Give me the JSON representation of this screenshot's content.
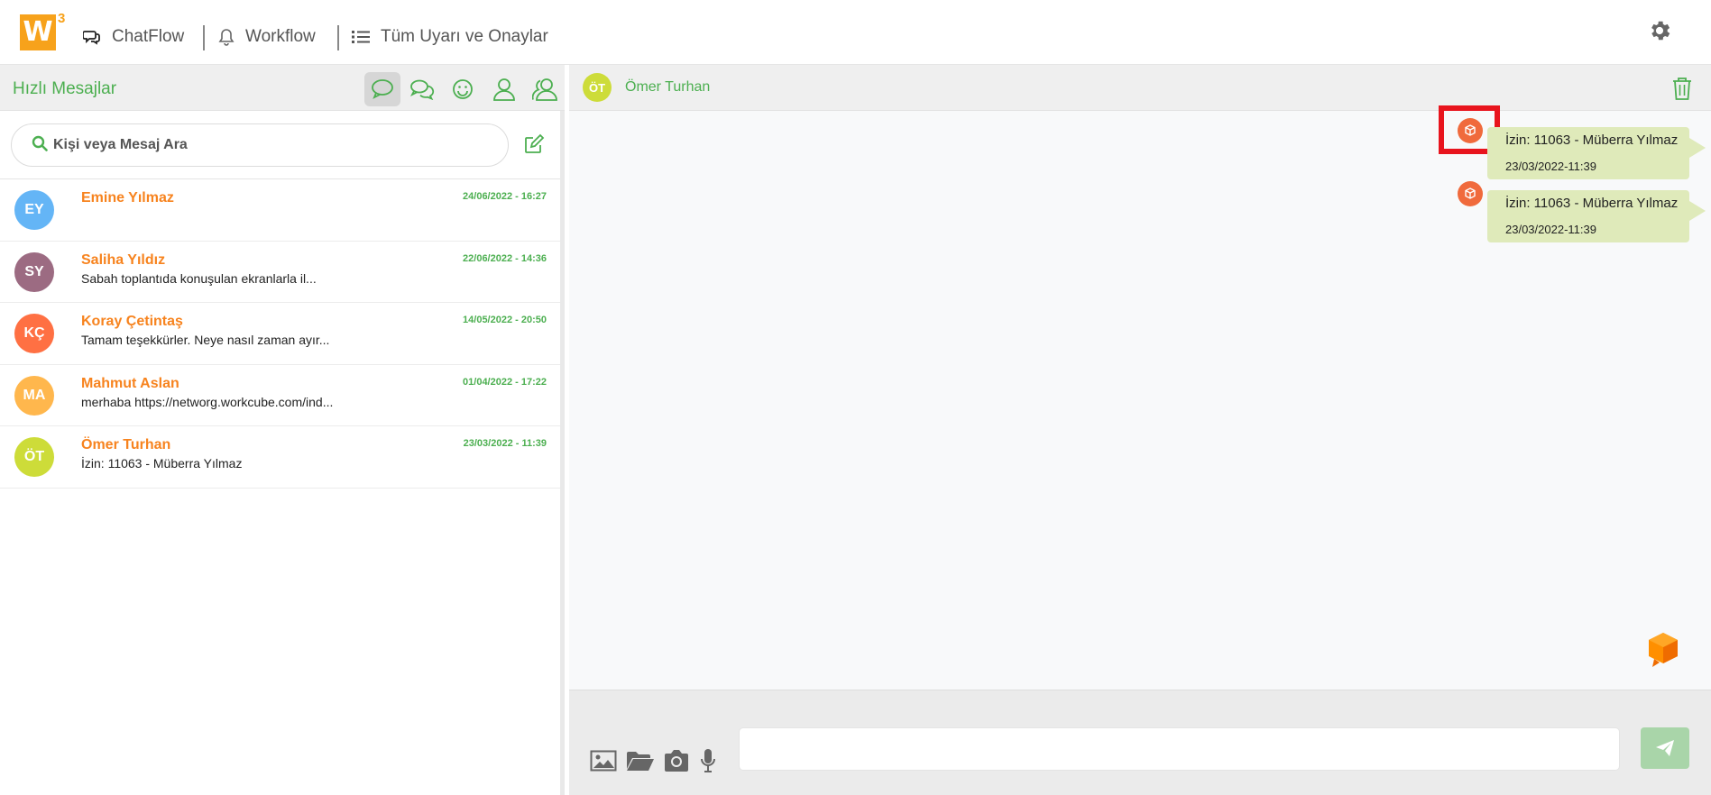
{
  "app": {
    "logo_text": "W",
    "logo_sup": "3"
  },
  "nav": {
    "items": [
      {
        "label": "ChatFlow"
      },
      {
        "label": "Workflow"
      },
      {
        "label": "Tüm Uyarı ve Onaylar"
      }
    ]
  },
  "sidebar": {
    "title": "Hızlı Mesajlar",
    "search_placeholder": "Kişi veya Mesaj Ara",
    "conversations": [
      {
        "initials": "EY",
        "name": "Emine Yılmaz",
        "preview": "",
        "time": "24/06/2022 - 16:27",
        "color": "#64b5f6"
      },
      {
        "initials": "SY",
        "name": "Saliha Yıldız",
        "preview": "Sabah toplantıda konuşulan ekranlarla il...",
        "time": "22/06/2022 - 14:36",
        "color": "#9c6b82"
      },
      {
        "initials": "KÇ",
        "name": "Koray Çetintaş",
        "preview": "Tamam teşekkürler. Neye nasıl zaman ayır...",
        "time": "14/05/2022 - 20:50",
        "color": "#ff7043"
      },
      {
        "initials": "MA",
        "name": "Mahmut Aslan",
        "preview": "merhaba https://networg.workcube.com/ind...",
        "time": "01/04/2022 - 17:22",
        "color": "#ffb74d"
      },
      {
        "initials": "ÖT",
        "name": "Ömer Turhan",
        "preview": "İzin: 11063 - Müberra Yılmaz",
        "time": "23/03/2022 - 11:39",
        "color": "#cddc39"
      }
    ]
  },
  "chat": {
    "contact_initials": "ÖT",
    "contact_name": "Ömer Turhan",
    "messages": [
      {
        "text": "İzin: 11063 - Müberra Yılmaz",
        "time": "23/03/2022-11:39"
      },
      {
        "text": "İzin: 11063 - Müberra Yılmaz",
        "time": "23/03/2022-11:39"
      }
    ],
    "input_value": ""
  },
  "colors": {
    "accent_green": "#4caf50",
    "name_orange": "#f7831e",
    "logo_orange": "#f7a21b",
    "bubble": "#dfeaba",
    "highlight_red": "#e8141d"
  }
}
